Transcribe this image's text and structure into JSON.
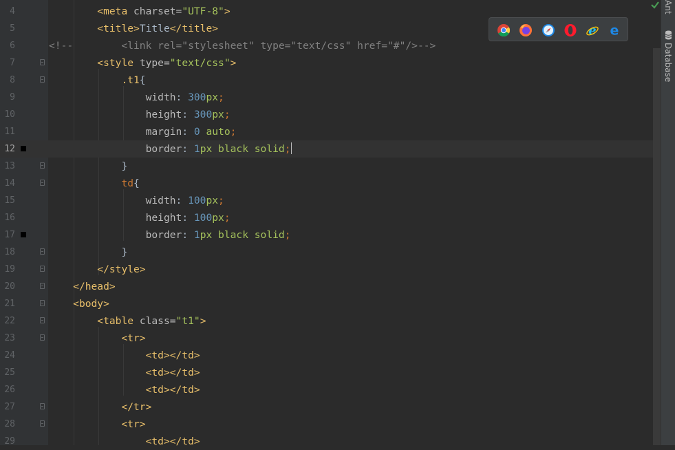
{
  "editor": {
    "current_line": 12,
    "lines": [
      {
        "n": "4",
        "bp": false,
        "fold": false,
        "current": false,
        "tokens": [
          {
            "t": "        "
          },
          {
            "c": "tag",
            "t": "<meta "
          },
          {
            "c": "attr",
            "t": "charset="
          },
          {
            "c": "val",
            "t": "\"UTF-8\""
          },
          {
            "c": "tag",
            "t": ">"
          }
        ]
      },
      {
        "n": "5",
        "bp": false,
        "fold": false,
        "current": false,
        "tokens": [
          {
            "t": "        "
          },
          {
            "c": "tag",
            "t": "<title>"
          },
          {
            "c": "text",
            "t": "Title"
          },
          {
            "c": "tag",
            "t": "</title>"
          }
        ]
      },
      {
        "n": "6",
        "bp": false,
        "fold": false,
        "current": false,
        "tokens": [
          {
            "c": "com",
            "t": "<!--        <link rel=\"stylesheet\" type=\"text/css\" href=\"#\"/>-->"
          }
        ]
      },
      {
        "n": "7",
        "bp": false,
        "fold": true,
        "current": false,
        "tokens": [
          {
            "t": "        "
          },
          {
            "c": "tag",
            "t": "<style "
          },
          {
            "c": "attr",
            "t": "type="
          },
          {
            "c": "val",
            "t": "\"text/css\""
          },
          {
            "c": "tag",
            "t": ">"
          }
        ]
      },
      {
        "n": "8",
        "bp": false,
        "fold": true,
        "current": false,
        "tokens": [
          {
            "t": "            "
          },
          {
            "c": "sel",
            "t": ".t1"
          },
          {
            "c": "text",
            "t": "{"
          }
        ]
      },
      {
        "n": "9",
        "bp": false,
        "fold": false,
        "current": false,
        "tokens": [
          {
            "t": "                "
          },
          {
            "c": "prop",
            "t": "width"
          },
          {
            "c": "text",
            "t": ": "
          },
          {
            "c": "num",
            "t": "300"
          },
          {
            "c": "kw",
            "t": "px"
          },
          {
            "c": "punct",
            "t": ";"
          }
        ]
      },
      {
        "n": "10",
        "bp": false,
        "fold": false,
        "current": false,
        "tokens": [
          {
            "t": "                "
          },
          {
            "c": "prop",
            "t": "height"
          },
          {
            "c": "text",
            "t": ": "
          },
          {
            "c": "num",
            "t": "300"
          },
          {
            "c": "kw",
            "t": "px"
          },
          {
            "c": "punct",
            "t": ";"
          }
        ]
      },
      {
        "n": "11",
        "bp": false,
        "fold": false,
        "current": false,
        "tokens": [
          {
            "t": "                "
          },
          {
            "c": "prop",
            "t": "margin"
          },
          {
            "c": "text",
            "t": ": "
          },
          {
            "c": "num",
            "t": "0"
          },
          {
            "c": "text",
            "t": " "
          },
          {
            "c": "kw",
            "t": "auto"
          },
          {
            "c": "punct",
            "t": ";"
          }
        ]
      },
      {
        "n": "12",
        "bp": true,
        "fold": false,
        "current": true,
        "tokens": [
          {
            "t": "                "
          },
          {
            "c": "prop",
            "t": "border"
          },
          {
            "c": "text",
            "t": ": "
          },
          {
            "c": "num",
            "t": "1"
          },
          {
            "c": "kw",
            "t": "px black solid"
          },
          {
            "c": "punct",
            "t": ";"
          }
        ]
      },
      {
        "n": "13",
        "bp": false,
        "fold": true,
        "current": false,
        "tokens": [
          {
            "t": "            "
          },
          {
            "c": "text",
            "t": "}"
          }
        ]
      },
      {
        "n": "14",
        "bp": false,
        "fold": true,
        "current": false,
        "tokens": [
          {
            "t": "            "
          },
          {
            "c": "punct",
            "t": "td"
          },
          {
            "c": "text",
            "t": "{"
          }
        ]
      },
      {
        "n": "15",
        "bp": false,
        "fold": false,
        "current": false,
        "tokens": [
          {
            "t": "                "
          },
          {
            "c": "prop",
            "t": "width"
          },
          {
            "c": "text",
            "t": ": "
          },
          {
            "c": "num",
            "t": "100"
          },
          {
            "c": "kw",
            "t": "px"
          },
          {
            "c": "punct",
            "t": ";"
          }
        ]
      },
      {
        "n": "16",
        "bp": false,
        "fold": false,
        "current": false,
        "tokens": [
          {
            "t": "                "
          },
          {
            "c": "prop",
            "t": "height"
          },
          {
            "c": "text",
            "t": ": "
          },
          {
            "c": "num",
            "t": "100"
          },
          {
            "c": "kw",
            "t": "px"
          },
          {
            "c": "punct",
            "t": ";"
          }
        ]
      },
      {
        "n": "17",
        "bp": true,
        "fold": false,
        "current": false,
        "tokens": [
          {
            "t": "                "
          },
          {
            "c": "prop",
            "t": "border"
          },
          {
            "c": "text",
            "t": ": "
          },
          {
            "c": "num",
            "t": "1"
          },
          {
            "c": "kw",
            "t": "px black solid"
          },
          {
            "c": "punct",
            "t": ";"
          }
        ]
      },
      {
        "n": "18",
        "bp": false,
        "fold": true,
        "current": false,
        "tokens": [
          {
            "t": "            "
          },
          {
            "c": "text",
            "t": "}"
          }
        ]
      },
      {
        "n": "19",
        "bp": false,
        "fold": true,
        "current": false,
        "tokens": [
          {
            "t": "        "
          },
          {
            "c": "tag",
            "t": "</style>"
          }
        ]
      },
      {
        "n": "20",
        "bp": false,
        "fold": true,
        "current": false,
        "tokens": [
          {
            "t": "    "
          },
          {
            "c": "tag",
            "t": "</head>"
          }
        ]
      },
      {
        "n": "21",
        "bp": false,
        "fold": true,
        "current": false,
        "tokens": [
          {
            "t": "    "
          },
          {
            "c": "tag",
            "t": "<body>"
          }
        ]
      },
      {
        "n": "22",
        "bp": false,
        "fold": true,
        "current": false,
        "tokens": [
          {
            "t": "        "
          },
          {
            "c": "tag",
            "t": "<table "
          },
          {
            "c": "attr",
            "t": "class="
          },
          {
            "c": "val",
            "t": "\"t1\""
          },
          {
            "c": "tag",
            "t": ">"
          }
        ]
      },
      {
        "n": "23",
        "bp": false,
        "fold": true,
        "current": false,
        "tokens": [
          {
            "t": "            "
          },
          {
            "c": "tag",
            "t": "<tr>"
          }
        ]
      },
      {
        "n": "24",
        "bp": false,
        "fold": false,
        "current": false,
        "tokens": [
          {
            "t": "                "
          },
          {
            "c": "tag",
            "t": "<td></td>"
          }
        ]
      },
      {
        "n": "25",
        "bp": false,
        "fold": false,
        "current": false,
        "tokens": [
          {
            "t": "                "
          },
          {
            "c": "tag",
            "t": "<td></td>"
          }
        ]
      },
      {
        "n": "26",
        "bp": false,
        "fold": false,
        "current": false,
        "tokens": [
          {
            "t": "                "
          },
          {
            "c": "tag",
            "t": "<td></td>"
          }
        ]
      },
      {
        "n": "27",
        "bp": false,
        "fold": true,
        "current": false,
        "tokens": [
          {
            "t": "            "
          },
          {
            "c": "tag",
            "t": "</tr>"
          }
        ]
      },
      {
        "n": "28",
        "bp": false,
        "fold": true,
        "current": false,
        "tokens": [
          {
            "t": "            "
          },
          {
            "c": "tag",
            "t": "<tr>"
          }
        ]
      },
      {
        "n": "29",
        "bp": false,
        "fold": false,
        "current": false,
        "tokens": [
          {
            "t": "                "
          },
          {
            "c": "tag",
            "t": "<td></td>"
          }
        ]
      }
    ]
  },
  "browser_bar": {
    "icons": [
      "chrome-icon",
      "firefox-icon",
      "safari-icon",
      "opera-icon",
      "internet-explorer-icon",
      "edge-icon"
    ]
  },
  "right_tabs": {
    "ant": "Ant",
    "database": "Database"
  },
  "colors": {
    "background": "#2b2b2b",
    "gutter": "#313335",
    "tag": "#e8bf6a",
    "string": "#a5c25c",
    "number": "#6897bb",
    "keyword": "#cc7832",
    "comment": "#808080"
  }
}
